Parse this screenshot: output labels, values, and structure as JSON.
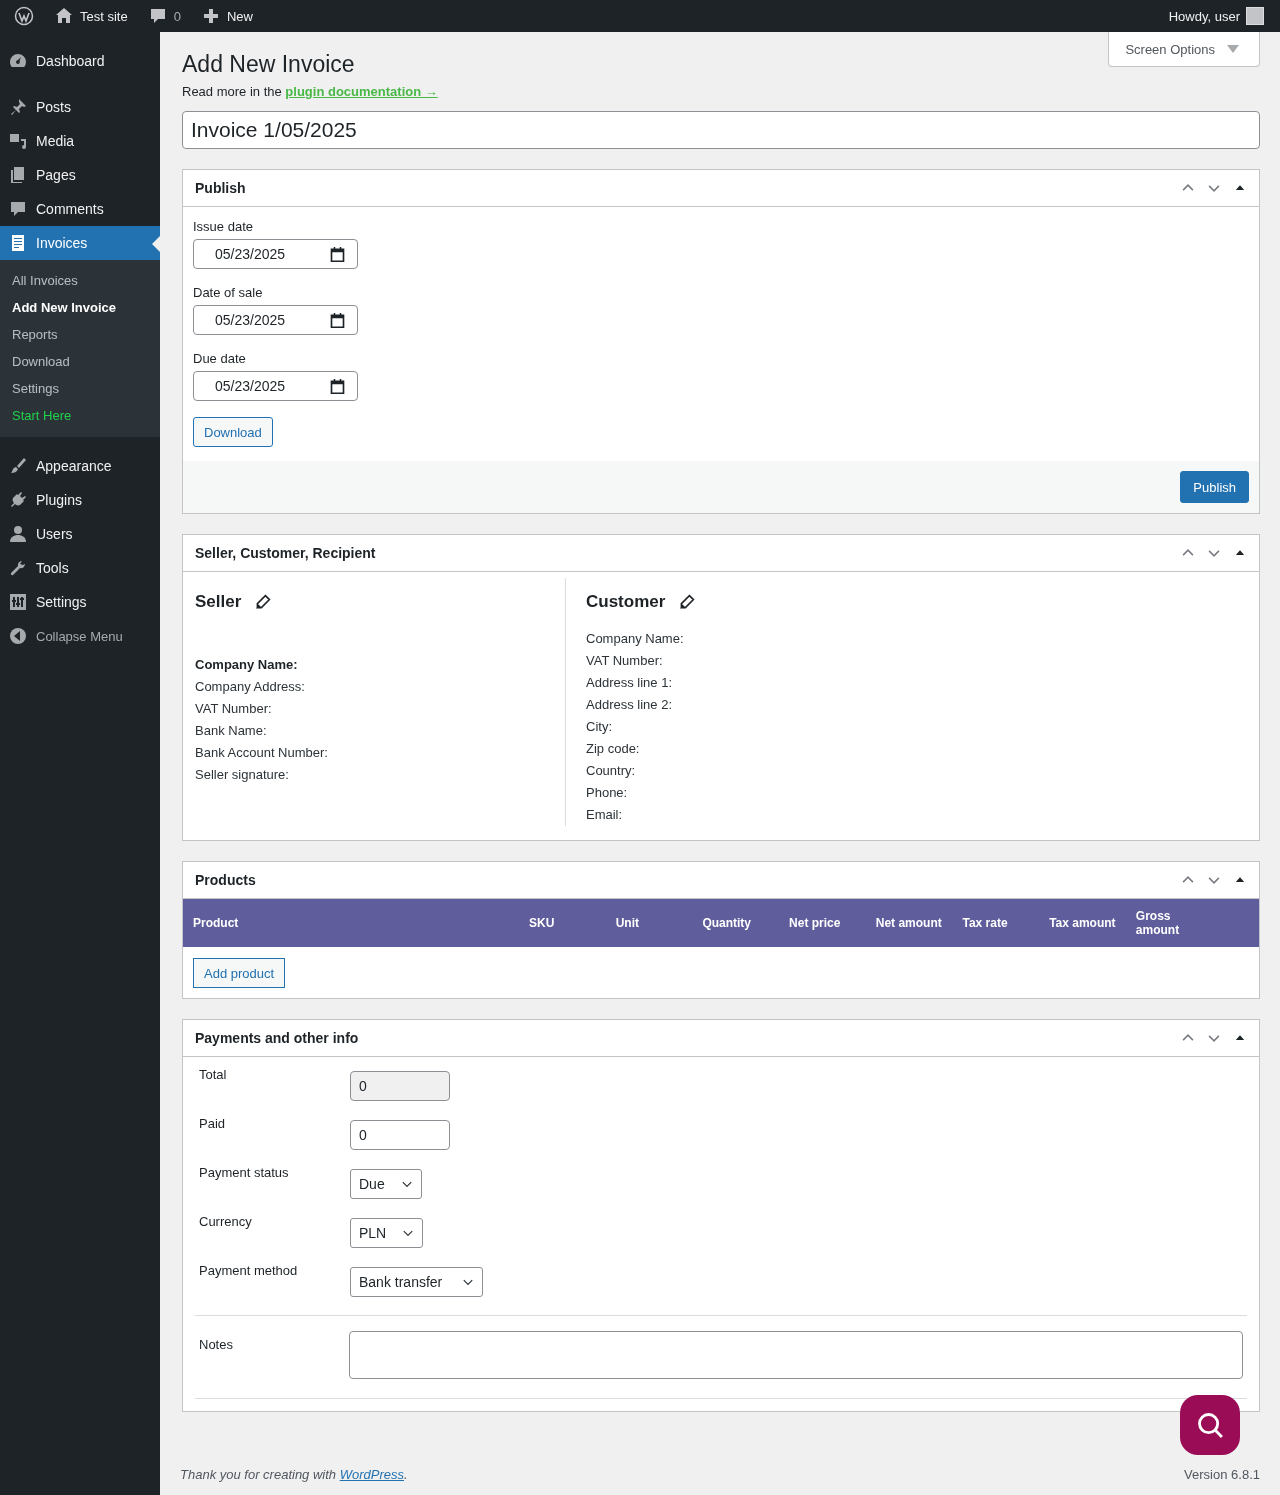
{
  "admin_bar": {
    "site": "Test site",
    "comments": "0",
    "new": "New",
    "greeting": "Howdy, user"
  },
  "sidebar": {
    "groups": [
      [
        {
          "label": "Dashboard",
          "selected": false
        }
      ],
      [
        {
          "label": "Posts",
          "selected": false
        },
        {
          "label": "Media",
          "selected": false
        },
        {
          "label": "Pages",
          "selected": false
        },
        {
          "label": "Comments",
          "selected": false
        },
        {
          "label": "Invoices",
          "selected": true
        }
      ],
      [
        {
          "label": "Appearance",
          "selected": false
        },
        {
          "label": "Plugins",
          "selected": false
        },
        {
          "label": "Users",
          "selected": false
        },
        {
          "label": "Tools",
          "selected": false
        },
        {
          "label": "Settings",
          "selected": false
        }
      ]
    ],
    "submenu": [
      {
        "label": "All Invoices",
        "selected": false,
        "kind": "link"
      },
      {
        "label": "Add New Invoice",
        "selected": true,
        "kind": "link"
      },
      {
        "label": "Reports",
        "selected": false,
        "kind": "link"
      },
      {
        "label": "Download",
        "selected": false,
        "kind": "link"
      },
      {
        "label": "Settings",
        "selected": false,
        "kind": "link"
      },
      {
        "label": "Start Here",
        "selected": false,
        "kind": "promo"
      }
    ],
    "collapse": "Collapse Menu"
  },
  "screen_options": "Screen Options",
  "page_title": "Add New Invoice",
  "doc_note": {
    "text": "Read more in the",
    "link": "plugin documentation →"
  },
  "title_field": {
    "value": "Invoice 1/05/2025"
  },
  "publish": {
    "title": "Publish",
    "fields": [
      {
        "label": "Issue date",
        "value": "05/23/2025"
      },
      {
        "label": "Date of sale",
        "value": "05/23/2025"
      },
      {
        "label": "Due date",
        "value": "05/23/2025"
      }
    ],
    "download_button": "Download",
    "publish_button": "Publish"
  },
  "parties": {
    "title": "Seller, Customer, Recipient",
    "seller": {
      "heading": "Seller",
      "fields": [
        {
          "label": "Company Name:",
          "bold": true
        },
        {
          "label": "Company Address:",
          "bold": false
        },
        {
          "label": "VAT Number:",
          "bold": false
        },
        {
          "label": "Bank Name:",
          "bold": false
        },
        {
          "label": "Bank Account Number:",
          "bold": false
        },
        {
          "label": "Seller signature:",
          "bold": false
        }
      ]
    },
    "customer": {
      "heading": "Customer",
      "fields": [
        {
          "label": "Company Name:",
          "bold": false
        },
        {
          "label": "VAT Number:",
          "bold": false
        },
        {
          "label": "Address line 1:",
          "bold": false
        },
        {
          "label": "Address line 2:",
          "bold": false
        },
        {
          "label": "City:",
          "bold": false
        },
        {
          "label": "Zip code:",
          "bold": false
        },
        {
          "label": "Country:",
          "bold": false
        },
        {
          "label": "Phone:",
          "bold": false
        },
        {
          "label": "Email:",
          "bold": false
        }
      ]
    }
  },
  "products": {
    "title": "Products",
    "columns": [
      "Product",
      "SKU",
      "Unit",
      "Quantity",
      "Net price",
      "Net amount",
      "Tax rate",
      "Tax amount",
      "Gross amount"
    ],
    "add_button": "Add product"
  },
  "payments": {
    "title": "Payments and other info",
    "rows": [
      {
        "label": "Total",
        "kind": "readonly",
        "value": "0"
      },
      {
        "label": "Paid",
        "kind": "input",
        "value": "0"
      },
      {
        "label": "Payment status",
        "kind": "select",
        "value": "Due"
      },
      {
        "label": "Currency",
        "kind": "select",
        "value": "PLN"
      },
      {
        "label": "Payment method",
        "kind": "select",
        "value": "Bank transfer"
      }
    ],
    "notes_label": "Notes"
  },
  "footer": {
    "text": "Thank you for creating with",
    "link": "WordPress",
    "end": ".",
    "version": "Version 6.8.1"
  }
}
